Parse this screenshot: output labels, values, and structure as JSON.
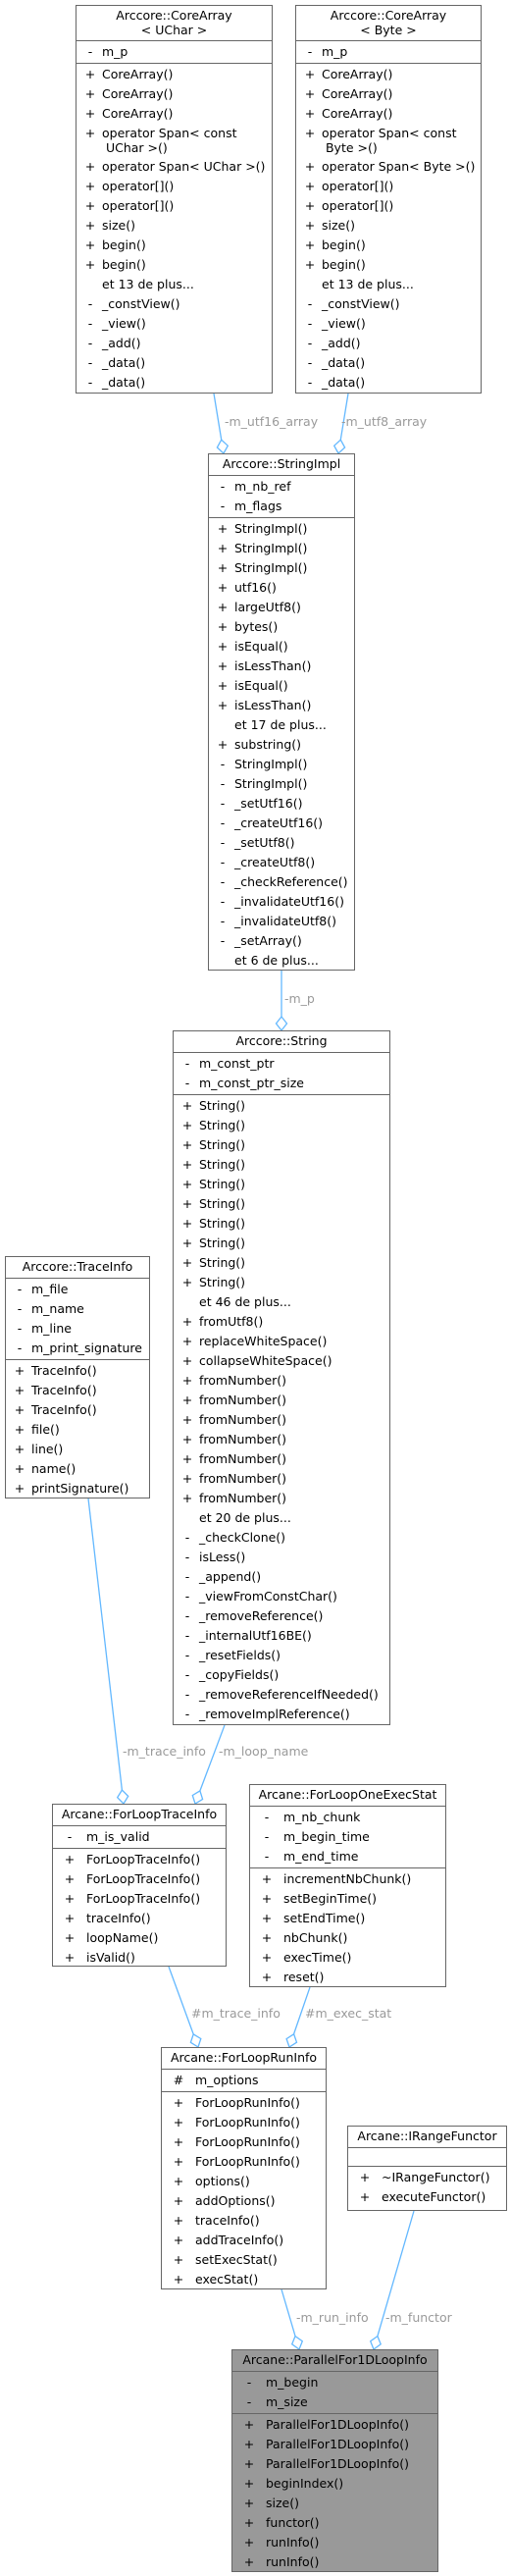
{
  "colors": {
    "edge": "#63b8ff",
    "edge_label": "#9a9a9a",
    "box_border": "#666666",
    "highlight_fill": "#999999"
  },
  "classes": {
    "corearray_uchar": {
      "title": "Arccore::CoreArray\n< UChar >",
      "attributes": [
        {
          "vis": "-",
          "name": "m_p"
        }
      ],
      "methods": [
        {
          "vis": "+",
          "name": "CoreArray()"
        },
        {
          "vis": "+",
          "name": "CoreArray()"
        },
        {
          "vis": "+",
          "name": "CoreArray()"
        },
        {
          "vis": "+",
          "name": "operator Span< const\n UChar >()"
        },
        {
          "vis": "+",
          "name": "operator Span< UChar >()"
        },
        {
          "vis": "+",
          "name": "operator[]()"
        },
        {
          "vis": "+",
          "name": "operator[]()"
        },
        {
          "vis": "+",
          "name": "size()"
        },
        {
          "vis": "+",
          "name": "begin()"
        },
        {
          "vis": "+",
          "name": "begin()"
        },
        {
          "vis": "",
          "name": "et 13 de plus..."
        },
        {
          "vis": "-",
          "name": "_constView()"
        },
        {
          "vis": "-",
          "name": "_view()"
        },
        {
          "vis": "-",
          "name": "_add()"
        },
        {
          "vis": "-",
          "name": "_data()"
        },
        {
          "vis": "-",
          "name": "_data()"
        }
      ]
    },
    "corearray_byte": {
      "title": "Arccore::CoreArray\n< Byte >",
      "attributes": [
        {
          "vis": "-",
          "name": "m_p"
        }
      ],
      "methods": [
        {
          "vis": "+",
          "name": "CoreArray()"
        },
        {
          "vis": "+",
          "name": "CoreArray()"
        },
        {
          "vis": "+",
          "name": "CoreArray()"
        },
        {
          "vis": "+",
          "name": "operator Span< const\n Byte >()"
        },
        {
          "vis": "+",
          "name": "operator Span< Byte >()"
        },
        {
          "vis": "+",
          "name": "operator[]()"
        },
        {
          "vis": "+",
          "name": "operator[]()"
        },
        {
          "vis": "+",
          "name": "size()"
        },
        {
          "vis": "+",
          "name": "begin()"
        },
        {
          "vis": "+",
          "name": "begin()"
        },
        {
          "vis": "",
          "name": "et 13 de plus..."
        },
        {
          "vis": "-",
          "name": "_constView()"
        },
        {
          "vis": "-",
          "name": "_view()"
        },
        {
          "vis": "-",
          "name": "_add()"
        },
        {
          "vis": "-",
          "name": "_data()"
        },
        {
          "vis": "-",
          "name": "_data()"
        }
      ]
    },
    "stringimpl": {
      "title": "Arccore::StringImpl",
      "attributes": [
        {
          "vis": "-",
          "name": "m_nb_ref"
        },
        {
          "vis": "-",
          "name": "m_flags"
        }
      ],
      "methods": [
        {
          "vis": "+",
          "name": "StringImpl()"
        },
        {
          "vis": "+",
          "name": "StringImpl()"
        },
        {
          "vis": "+",
          "name": "StringImpl()"
        },
        {
          "vis": "+",
          "name": "utf16()"
        },
        {
          "vis": "+",
          "name": "largeUtf8()"
        },
        {
          "vis": "+",
          "name": "bytes()"
        },
        {
          "vis": "+",
          "name": "isEqual()"
        },
        {
          "vis": "+",
          "name": "isLessThan()"
        },
        {
          "vis": "+",
          "name": "isEqual()"
        },
        {
          "vis": "+",
          "name": "isLessThan()"
        },
        {
          "vis": "",
          "name": "et 17 de plus..."
        },
        {
          "vis": "+",
          "name": "substring()"
        },
        {
          "vis": "-",
          "name": "StringImpl()"
        },
        {
          "vis": "-",
          "name": "StringImpl()"
        },
        {
          "vis": "-",
          "name": "_setUtf16()"
        },
        {
          "vis": "-",
          "name": "_createUtf16()"
        },
        {
          "vis": "-",
          "name": "_setUtf8()"
        },
        {
          "vis": "-",
          "name": "_createUtf8()"
        },
        {
          "vis": "-",
          "name": "_checkReference()"
        },
        {
          "vis": "-",
          "name": "_invalidateUtf16()"
        },
        {
          "vis": "-",
          "name": "_invalidateUtf8()"
        },
        {
          "vis": "-",
          "name": "_setArray()"
        },
        {
          "vis": "",
          "name": "et 6 de plus..."
        }
      ]
    },
    "string": {
      "title": "Arccore::String",
      "attributes": [
        {
          "vis": "-",
          "name": "m_const_ptr"
        },
        {
          "vis": "-",
          "name": "m_const_ptr_size"
        }
      ],
      "methods": [
        {
          "vis": "+",
          "name": "String()"
        },
        {
          "vis": "+",
          "name": "String()"
        },
        {
          "vis": "+",
          "name": "String()"
        },
        {
          "vis": "+",
          "name": "String()"
        },
        {
          "vis": "+",
          "name": "String()"
        },
        {
          "vis": "+",
          "name": "String()"
        },
        {
          "vis": "+",
          "name": "String()"
        },
        {
          "vis": "+",
          "name": "String()"
        },
        {
          "vis": "+",
          "name": "String()"
        },
        {
          "vis": "+",
          "name": "String()"
        },
        {
          "vis": "",
          "name": "et 46 de plus..."
        },
        {
          "vis": "+",
          "name": "fromUtf8()"
        },
        {
          "vis": "+",
          "name": "replaceWhiteSpace()"
        },
        {
          "vis": "+",
          "name": "collapseWhiteSpace()"
        },
        {
          "vis": "+",
          "name": "fromNumber()"
        },
        {
          "vis": "+",
          "name": "fromNumber()"
        },
        {
          "vis": "+",
          "name": "fromNumber()"
        },
        {
          "vis": "+",
          "name": "fromNumber()"
        },
        {
          "vis": "+",
          "name": "fromNumber()"
        },
        {
          "vis": "+",
          "name": "fromNumber()"
        },
        {
          "vis": "+",
          "name": "fromNumber()"
        },
        {
          "vis": "",
          "name": "et 20 de plus..."
        },
        {
          "vis": "-",
          "name": "_checkClone()"
        },
        {
          "vis": "-",
          "name": "isLess()"
        },
        {
          "vis": "-",
          "name": "_append()"
        },
        {
          "vis": "-",
          "name": "_viewFromConstChar()"
        },
        {
          "vis": "-",
          "name": "_removeReference()"
        },
        {
          "vis": "-",
          "name": "_internalUtf16BE()"
        },
        {
          "vis": "-",
          "name": "_resetFields()"
        },
        {
          "vis": "-",
          "name": "_copyFields()"
        },
        {
          "vis": "-",
          "name": "_removeReferenceIfNeeded()"
        },
        {
          "vis": "-",
          "name": "_removeImplReference()"
        }
      ]
    },
    "traceinfo": {
      "title": "Arccore::TraceInfo",
      "attributes": [
        {
          "vis": "-",
          "name": "m_file"
        },
        {
          "vis": "-",
          "name": "m_name"
        },
        {
          "vis": "-",
          "name": "m_line"
        },
        {
          "vis": "-",
          "name": "m_print_signature"
        }
      ],
      "methods": [
        {
          "vis": "+",
          "name": "TraceInfo()"
        },
        {
          "vis": "+",
          "name": "TraceInfo()"
        },
        {
          "vis": "+",
          "name": "TraceInfo()"
        },
        {
          "vis": "+",
          "name": "file()"
        },
        {
          "vis": "+",
          "name": "line()"
        },
        {
          "vis": "+",
          "name": "name()"
        },
        {
          "vis": "+",
          "name": "printSignature()"
        }
      ]
    },
    "forlooptraceinfo": {
      "title": "Arcane::ForLoopTraceInfo",
      "attributes": [
        {
          "vis": "-",
          "name": "m_is_valid"
        }
      ],
      "methods": [
        {
          "vis": "+",
          "name": "ForLoopTraceInfo()"
        },
        {
          "vis": "+",
          "name": "ForLoopTraceInfo()"
        },
        {
          "vis": "+",
          "name": "ForLoopTraceInfo()"
        },
        {
          "vis": "+",
          "name": "traceInfo()"
        },
        {
          "vis": "+",
          "name": "loopName()"
        },
        {
          "vis": "+",
          "name": "isValid()"
        }
      ]
    },
    "forloooneexecstat": {
      "title": "Arcane::ForLoopOneExecStat",
      "attributes": [
        {
          "vis": "-",
          "name": "m_nb_chunk"
        },
        {
          "vis": "-",
          "name": "m_begin_time"
        },
        {
          "vis": "-",
          "name": "m_end_time"
        }
      ],
      "methods": [
        {
          "vis": "+",
          "name": "incrementNbChunk()"
        },
        {
          "vis": "+",
          "name": "setBeginTime()"
        },
        {
          "vis": "+",
          "name": "setEndTime()"
        },
        {
          "vis": "+",
          "name": "nbChunk()"
        },
        {
          "vis": "+",
          "name": "execTime()"
        },
        {
          "vis": "+",
          "name": "reset()"
        }
      ]
    },
    "forlooprninfo": {
      "title": "Arcane::ForLoopRunInfo",
      "attributes": [
        {
          "vis": "#",
          "name": "m_options"
        }
      ],
      "methods": [
        {
          "vis": "+",
          "name": "ForLoopRunInfo()"
        },
        {
          "vis": "+",
          "name": "ForLoopRunInfo()"
        },
        {
          "vis": "+",
          "name": "ForLoopRunInfo()"
        },
        {
          "vis": "+",
          "name": "ForLoopRunInfo()"
        },
        {
          "vis": "+",
          "name": "options()"
        },
        {
          "vis": "+",
          "name": "addOptions()"
        },
        {
          "vis": "+",
          "name": "traceInfo()"
        },
        {
          "vis": "+",
          "name": "addTraceInfo()"
        },
        {
          "vis": "+",
          "name": "setExecStat()"
        },
        {
          "vis": "+",
          "name": "execStat()"
        }
      ]
    },
    "irangefunctor": {
      "title": "Arcane::IRangeFunctor",
      "attributes": [],
      "methods": [
        {
          "vis": "+",
          "name": "~IRangeFunctor()"
        },
        {
          "vis": "+",
          "name": "executeFunctor()"
        }
      ]
    },
    "parallelfor1dloopinfo": {
      "title": "Arcane::ParallelFor1DLoopInfo",
      "attributes": [
        {
          "vis": "-",
          "name": "m_begin"
        },
        {
          "vis": "-",
          "name": "m_size"
        }
      ],
      "methods": [
        {
          "vis": "+",
          "name": "ParallelFor1DLoopInfo()"
        },
        {
          "vis": "+",
          "name": "ParallelFor1DLoopInfo()"
        },
        {
          "vis": "+",
          "name": "ParallelFor1DLoopInfo()"
        },
        {
          "vis": "+",
          "name": "beginIndex()"
        },
        {
          "vis": "+",
          "name": "size()"
        },
        {
          "vis": "+",
          "name": "functor()"
        },
        {
          "vis": "+",
          "name": "runInfo()"
        },
        {
          "vis": "+",
          "name": "runInfo()"
        }
      ]
    }
  },
  "edges": [
    {
      "from": "corearray_uchar",
      "to": "stringimpl",
      "label": "-m_utf16_array"
    },
    {
      "from": "corearray_byte",
      "to": "stringimpl",
      "label": "-m_utf8_array"
    },
    {
      "from": "stringimpl",
      "to": "string",
      "label": "-m_p"
    },
    {
      "from": "traceinfo",
      "to": "forlooptraceinfo",
      "label": "-m_trace_info"
    },
    {
      "from": "string",
      "to": "forlooptraceinfo",
      "label": "-m_loop_name"
    },
    {
      "from": "forlooptraceinfo",
      "to": "forlooprninfo",
      "label": "#m_trace_info"
    },
    {
      "from": "forloooneexecstat",
      "to": "forlooprninfo",
      "label": "#m_exec_stat"
    },
    {
      "from": "forlooprninfo",
      "to": "parallelfor1dloopinfo",
      "label": "-m_run_info"
    },
    {
      "from": "irangefunctor",
      "to": "parallelfor1dloopinfo",
      "label": "-m_functor"
    }
  ]
}
